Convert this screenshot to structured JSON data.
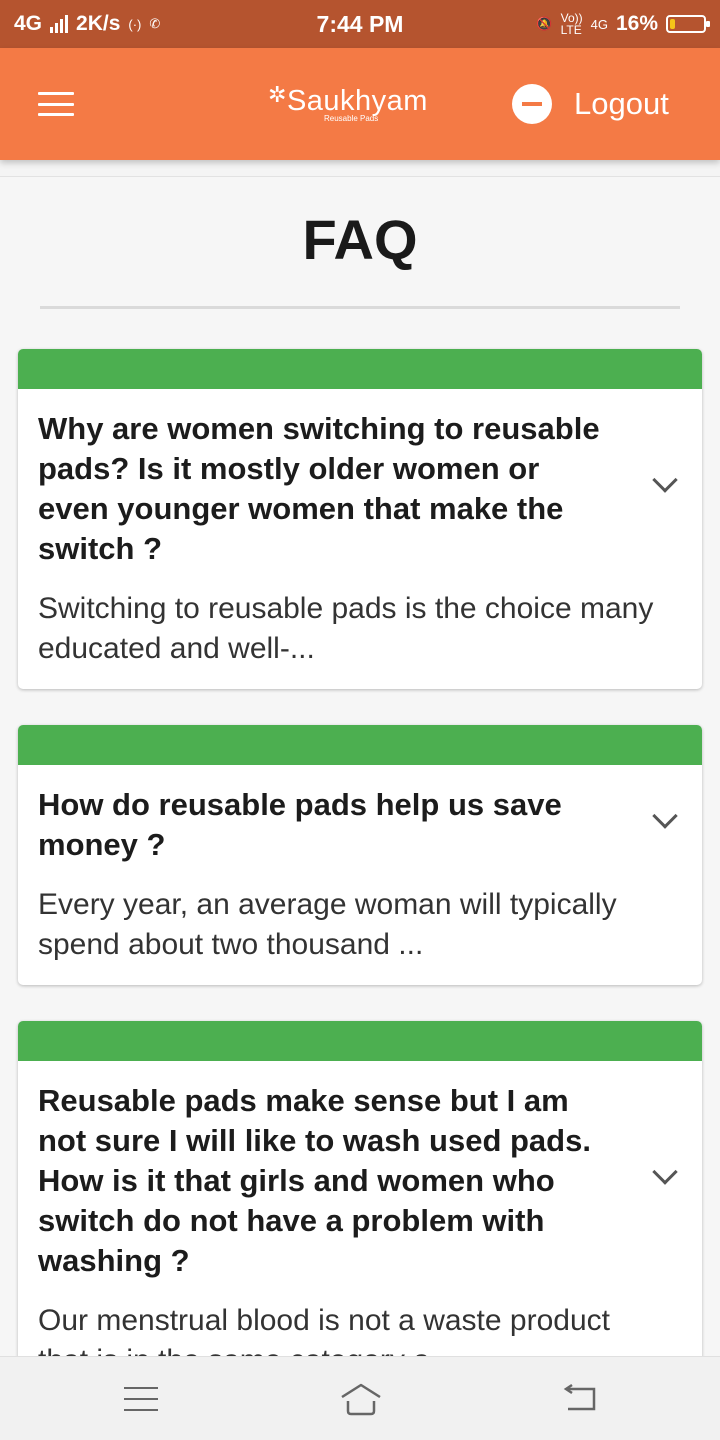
{
  "status_bar": {
    "network": "4G",
    "speed": "2K/s",
    "time": "7:44 PM",
    "lte": "LTE",
    "net_right": "4G",
    "volte": "Vo))",
    "battery": "16%",
    "battery_level": 0.16,
    "icons": [
      "signal-icon",
      "hotspot-icon",
      "whatsapp-icon",
      "mute-bell-icon",
      "battery-icon"
    ]
  },
  "app_bar": {
    "logo_text": "Saukhyam",
    "logo_subtitle": "Reusable Pads",
    "logout_label": "Logout",
    "background": "#f47a45"
  },
  "page": {
    "title": "FAQ"
  },
  "faqs": [
    {
      "question": "Why are women switching to reusable pads? Is it mostly older women or even younger women that make the switch ?",
      "answer": "Switching to reusable pads is the choice many educated and well-..."
    },
    {
      "question": "How do reusable pads help us save money ?",
      "answer": "Every year, an average woman will typically spend about two thousand ..."
    },
    {
      "question": "Reusable pads make sense but I am not sure I will like to wash used pads. How is it that girls and women who switch do not have a problem with washing ?",
      "answer": "Our menstrual blood is not a waste product that is in the same category a"
    }
  ],
  "colors": {
    "accent_green": "#4caf50",
    "status_bar": "#b5542f",
    "app_bar": "#f47a45"
  }
}
